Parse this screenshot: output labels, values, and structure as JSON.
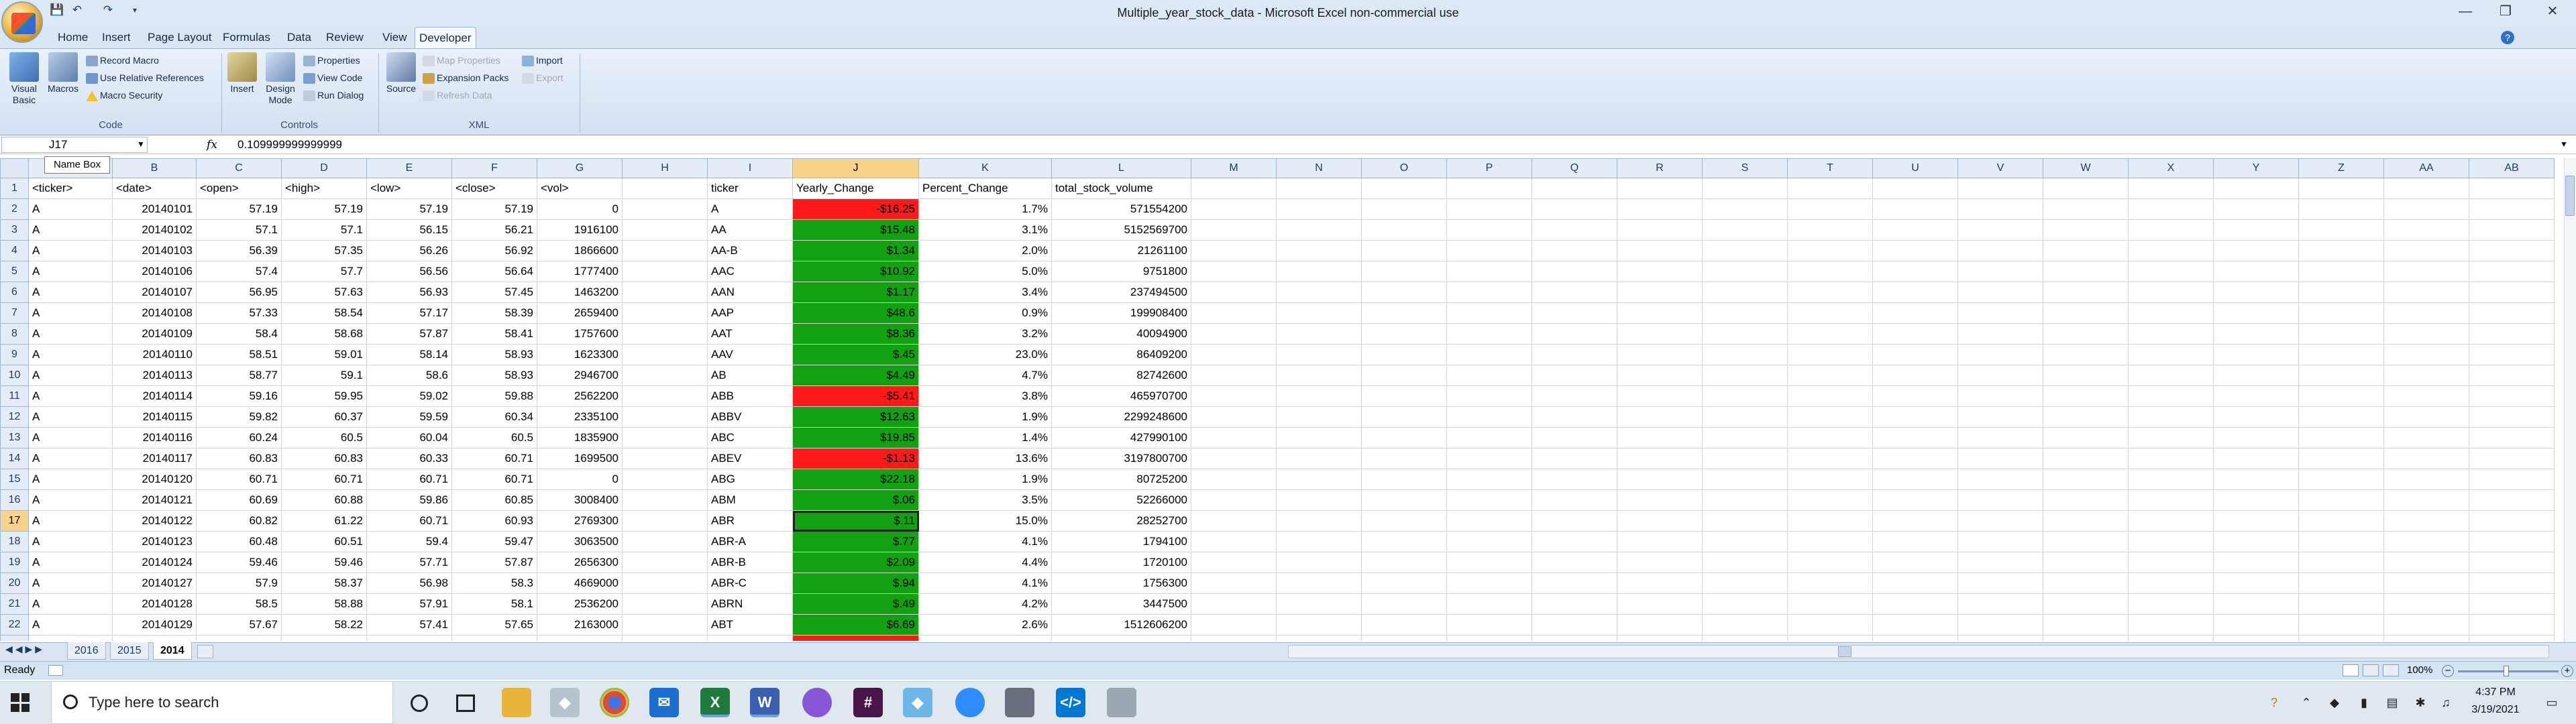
{
  "window": {
    "title": "Multiple_year_stock_data - Microsoft Excel non-commercial use"
  },
  "ribbon_tabs": [
    "Home",
    "Insert",
    "Page Layout",
    "Formulas",
    "Data",
    "Review",
    "View",
    "Developer"
  ],
  "ribbon": {
    "code_group": {
      "label": "Code",
      "visual_basic": "Visual Basic",
      "macros": "Macros",
      "record_macro": "Record Macro",
      "relative_refs": "Use Relative References",
      "macro_security": "Macro Security"
    },
    "controls_group": {
      "label": "Controls",
      "insert": "Insert",
      "design_mode": "Design Mode",
      "properties": "Properties",
      "view_code": "View Code",
      "run_dialog": "Run Dialog"
    },
    "xml_group": {
      "label": "XML",
      "source": "Source",
      "map_properties": "Map Properties",
      "expansion_packs": "Expansion Packs",
      "refresh_data": "Refresh Data",
      "import": "Import",
      "export": "Export"
    }
  },
  "formula_bar": {
    "name_box": "J17",
    "name_box_tooltip": "Name Box",
    "fx": "fx",
    "value": "0.109999999999999"
  },
  "columns": [
    "A",
    "B",
    "C",
    "D",
    "E",
    "F",
    "G",
    "H",
    "I",
    "J",
    "K",
    "L",
    "M",
    "N",
    "O",
    "P",
    "Q",
    "R",
    "S",
    "T",
    "U",
    "V",
    "W",
    "X",
    "Y",
    "Z",
    "AA",
    "AB"
  ],
  "rows": [
    {
      "n": "1",
      "a": "<ticker>",
      "b": "<date>",
      "c": "<open>",
      "d": "<high>",
      "e": "<low>",
      "f": "<close>",
      "g": "<vol>",
      "i": "ticker",
      "j": "Yearly_Change",
      "k": "Percent_Change",
      "l": "total_stock_volume",
      "hdr": true
    },
    {
      "n": "2",
      "a": "A",
      "b": "20140101",
      "c": "57.19",
      "d": "57.19",
      "e": "57.19",
      "f": "57.19",
      "g": "0",
      "i": "A",
      "j": "-$16.25",
      "k": "1.7%",
      "l": "571554200",
      "neg": true
    },
    {
      "n": "3",
      "a": "A",
      "b": "20140102",
      "c": "57.1",
      "d": "57.1",
      "e": "56.15",
      "f": "56.21",
      "g": "1916100",
      "i": "AA",
      "j": "$15.48",
      "k": "3.1%",
      "l": "5152569700"
    },
    {
      "n": "4",
      "a": "A",
      "b": "20140103",
      "c": "56.39",
      "d": "57.35",
      "e": "56.26",
      "f": "56.92",
      "g": "1866600",
      "i": "AA-B",
      "j": "$1.34",
      "k": "2.0%",
      "l": "21261100"
    },
    {
      "n": "5",
      "a": "A",
      "b": "20140106",
      "c": "57.4",
      "d": "57.7",
      "e": "56.56",
      "f": "56.64",
      "g": "1777400",
      "i": "AAC",
      "j": "$10.92",
      "k": "5.0%",
      "l": "9751800"
    },
    {
      "n": "6",
      "a": "A",
      "b": "20140107",
      "c": "56.95",
      "d": "57.63",
      "e": "56.93",
      "f": "57.45",
      "g": "1463200",
      "i": "AAN",
      "j": "$1.17",
      "k": "3.4%",
      "l": "237494500"
    },
    {
      "n": "7",
      "a": "A",
      "b": "20140108",
      "c": "57.33",
      "d": "58.54",
      "e": "57.17",
      "f": "58.39",
      "g": "2659400",
      "i": "AAP",
      "j": "$48.6",
      "k": "0.9%",
      "l": "199908400"
    },
    {
      "n": "8",
      "a": "A",
      "b": "20140109",
      "c": "58.4",
      "d": "58.68",
      "e": "57.87",
      "f": "58.41",
      "g": "1757600",
      "i": "AAT",
      "j": "$8.36",
      "k": "3.2%",
      "l": "40094900"
    },
    {
      "n": "9",
      "a": "A",
      "b": "20140110",
      "c": "58.51",
      "d": "59.01",
      "e": "58.14",
      "f": "58.93",
      "g": "1623300",
      "i": "AAV",
      "j": "$.45",
      "k": "23.0%",
      "l": "86409200"
    },
    {
      "n": "10",
      "a": "A",
      "b": "20140113",
      "c": "58.77",
      "d": "59.1",
      "e": "58.6",
      "f": "58.93",
      "g": "2946700",
      "i": "AB",
      "j": "$4.49",
      "k": "4.7%",
      "l": "82742600"
    },
    {
      "n": "11",
      "a": "A",
      "b": "20140114",
      "c": "59.16",
      "d": "59.95",
      "e": "59.02",
      "f": "59.88",
      "g": "2562200",
      "i": "ABB",
      "j": "-$5.41",
      "k": "3.8%",
      "l": "465970700",
      "neg": true
    },
    {
      "n": "12",
      "a": "A",
      "b": "20140115",
      "c": "59.82",
      "d": "60.37",
      "e": "59.59",
      "f": "60.34",
      "g": "2335100",
      "i": "ABBV",
      "j": "$12.63",
      "k": "1.9%",
      "l": "2299248600"
    },
    {
      "n": "13",
      "a": "A",
      "b": "20140116",
      "c": "60.24",
      "d": "60.5",
      "e": "60.04",
      "f": "60.5",
      "g": "1835900",
      "i": "ABC",
      "j": "$19.85",
      "k": "1.4%",
      "l": "427990100"
    },
    {
      "n": "14",
      "a": "A",
      "b": "20140117",
      "c": "60.83",
      "d": "60.83",
      "e": "60.33",
      "f": "60.71",
      "g": "1699500",
      "i": "ABEV",
      "j": "-$1.13",
      "k": "13.6%",
      "l": "3197800700",
      "neg": true
    },
    {
      "n": "15",
      "a": "A",
      "b": "20140120",
      "c": "60.71",
      "d": "60.71",
      "e": "60.71",
      "f": "60.71",
      "g": "0",
      "i": "ABG",
      "j": "$22.18",
      "k": "1.9%",
      "l": "80725200"
    },
    {
      "n": "16",
      "a": "A",
      "b": "20140121",
      "c": "60.69",
      "d": "60.88",
      "e": "59.86",
      "f": "60.85",
      "g": "3008400",
      "i": "ABM",
      "j": "$.06",
      "k": "3.5%",
      "l": "52266000"
    },
    {
      "n": "17",
      "a": "A",
      "b": "20140122",
      "c": "60.82",
      "d": "61.22",
      "e": "60.71",
      "f": "60.93",
      "g": "2769300",
      "i": "ABR",
      "j": "$.11",
      "k": "15.0%",
      "l": "28252700",
      "active": true
    },
    {
      "n": "18",
      "a": "A",
      "b": "20140123",
      "c": "60.48",
      "d": "60.51",
      "e": "59.4",
      "f": "59.47",
      "g": "3063500",
      "i": "ABR-A",
      "j": "$.77",
      "k": "4.1%",
      "l": "1794100"
    },
    {
      "n": "19",
      "a": "A",
      "b": "20140124",
      "c": "59.46",
      "d": "59.46",
      "e": "57.71",
      "f": "57.87",
      "g": "2656300",
      "i": "ABR-B",
      "j": "$2.09",
      "k": "4.4%",
      "l": "1720100"
    },
    {
      "n": "20",
      "a": "A",
      "b": "20140127",
      "c": "57.9",
      "d": "58.37",
      "e": "56.98",
      "f": "58.3",
      "g": "4669000",
      "i": "ABR-C",
      "j": "$.94",
      "k": "4.1%",
      "l": "1756300"
    },
    {
      "n": "21",
      "a": "A",
      "b": "20140128",
      "c": "58.5",
      "d": "58.88",
      "e": "57.91",
      "f": "58.1",
      "g": "2536200",
      "i": "ABRN",
      "j": "$.49",
      "k": "4.2%",
      "l": "3447500"
    },
    {
      "n": "22",
      "a": "A",
      "b": "20140129",
      "c": "57.67",
      "d": "58.22",
      "e": "57.41",
      "f": "57.65",
      "g": "2163000",
      "i": "ABT",
      "j": "$6.69",
      "k": "2.6%",
      "l": "1512606200"
    }
  ],
  "sheet_tabs": [
    "2016",
    "2015",
    "2014"
  ],
  "status": {
    "ready": "Ready",
    "zoom": "100%"
  },
  "taskbar": {
    "search_placeholder": "Type here to search",
    "time": "4:37 PM",
    "date": "3/19/2021"
  },
  "colors": {
    "positive": "#11a111",
    "negative": "#ff1a1a",
    "ribbon": "#d4e1f2"
  }
}
